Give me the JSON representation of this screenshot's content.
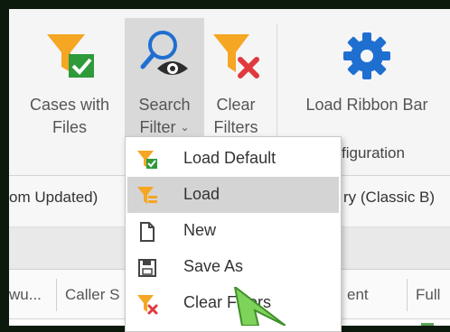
{
  "ribbon": {
    "buttons": [
      {
        "name": "cases-with-files",
        "line1": "Cases with",
        "line2": "Files"
      },
      {
        "name": "search-filter",
        "line1": "Search",
        "line2": "Filter"
      },
      {
        "name": "clear-filters",
        "line1": "Clear",
        "line2": "Filters"
      },
      {
        "name": "load-ribbon-bar",
        "line1": "Load Ribbon Bar",
        "line2": ""
      }
    ],
    "group_caption_partial": "figuration"
  },
  "toolbar_row": {
    "left_text_partial": "om Updated)",
    "right_text_partial": "ry (Classic B)"
  },
  "grid": {
    "columns": [
      "wu...",
      "Caller S",
      "ent",
      "Full"
    ]
  },
  "menu": {
    "items": [
      {
        "label": "Load Default",
        "icon": "funnel-check-icon"
      },
      {
        "label": "Load",
        "icon": "funnel-list-icon"
      },
      {
        "label": "New",
        "icon": "new-document-icon"
      },
      {
        "label": "Save As",
        "icon": "save-icon"
      },
      {
        "label": "Clear Filters",
        "icon": "funnel-clear-icon"
      }
    ]
  },
  "colors": {
    "funnel_orange": "#f5a623",
    "check_green": "#2e9a3a",
    "clear_red": "#e0393e",
    "gear_blue": "#1f6fd1"
  }
}
